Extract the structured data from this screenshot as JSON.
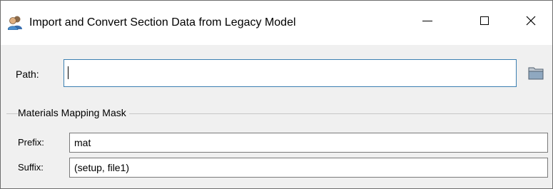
{
  "window": {
    "title": "Import and Convert Section Data from Legacy Model",
    "icon": "people-icon",
    "controls": [
      "minimize-icon",
      "maximize-icon",
      "close-icon"
    ]
  },
  "path": {
    "label": "Path:",
    "value": "",
    "browse_icon": "folder-icon"
  },
  "materials_mapping": {
    "title": "Materials Mapping Mask",
    "prefix": {
      "label": "Prefix:",
      "value": "mat"
    },
    "suffix": {
      "label": "Suffix:",
      "value": "(setup, file1)"
    }
  },
  "colors": {
    "focus_border": "#3c7fb1",
    "dialog_bg": "#f0f0f0"
  }
}
